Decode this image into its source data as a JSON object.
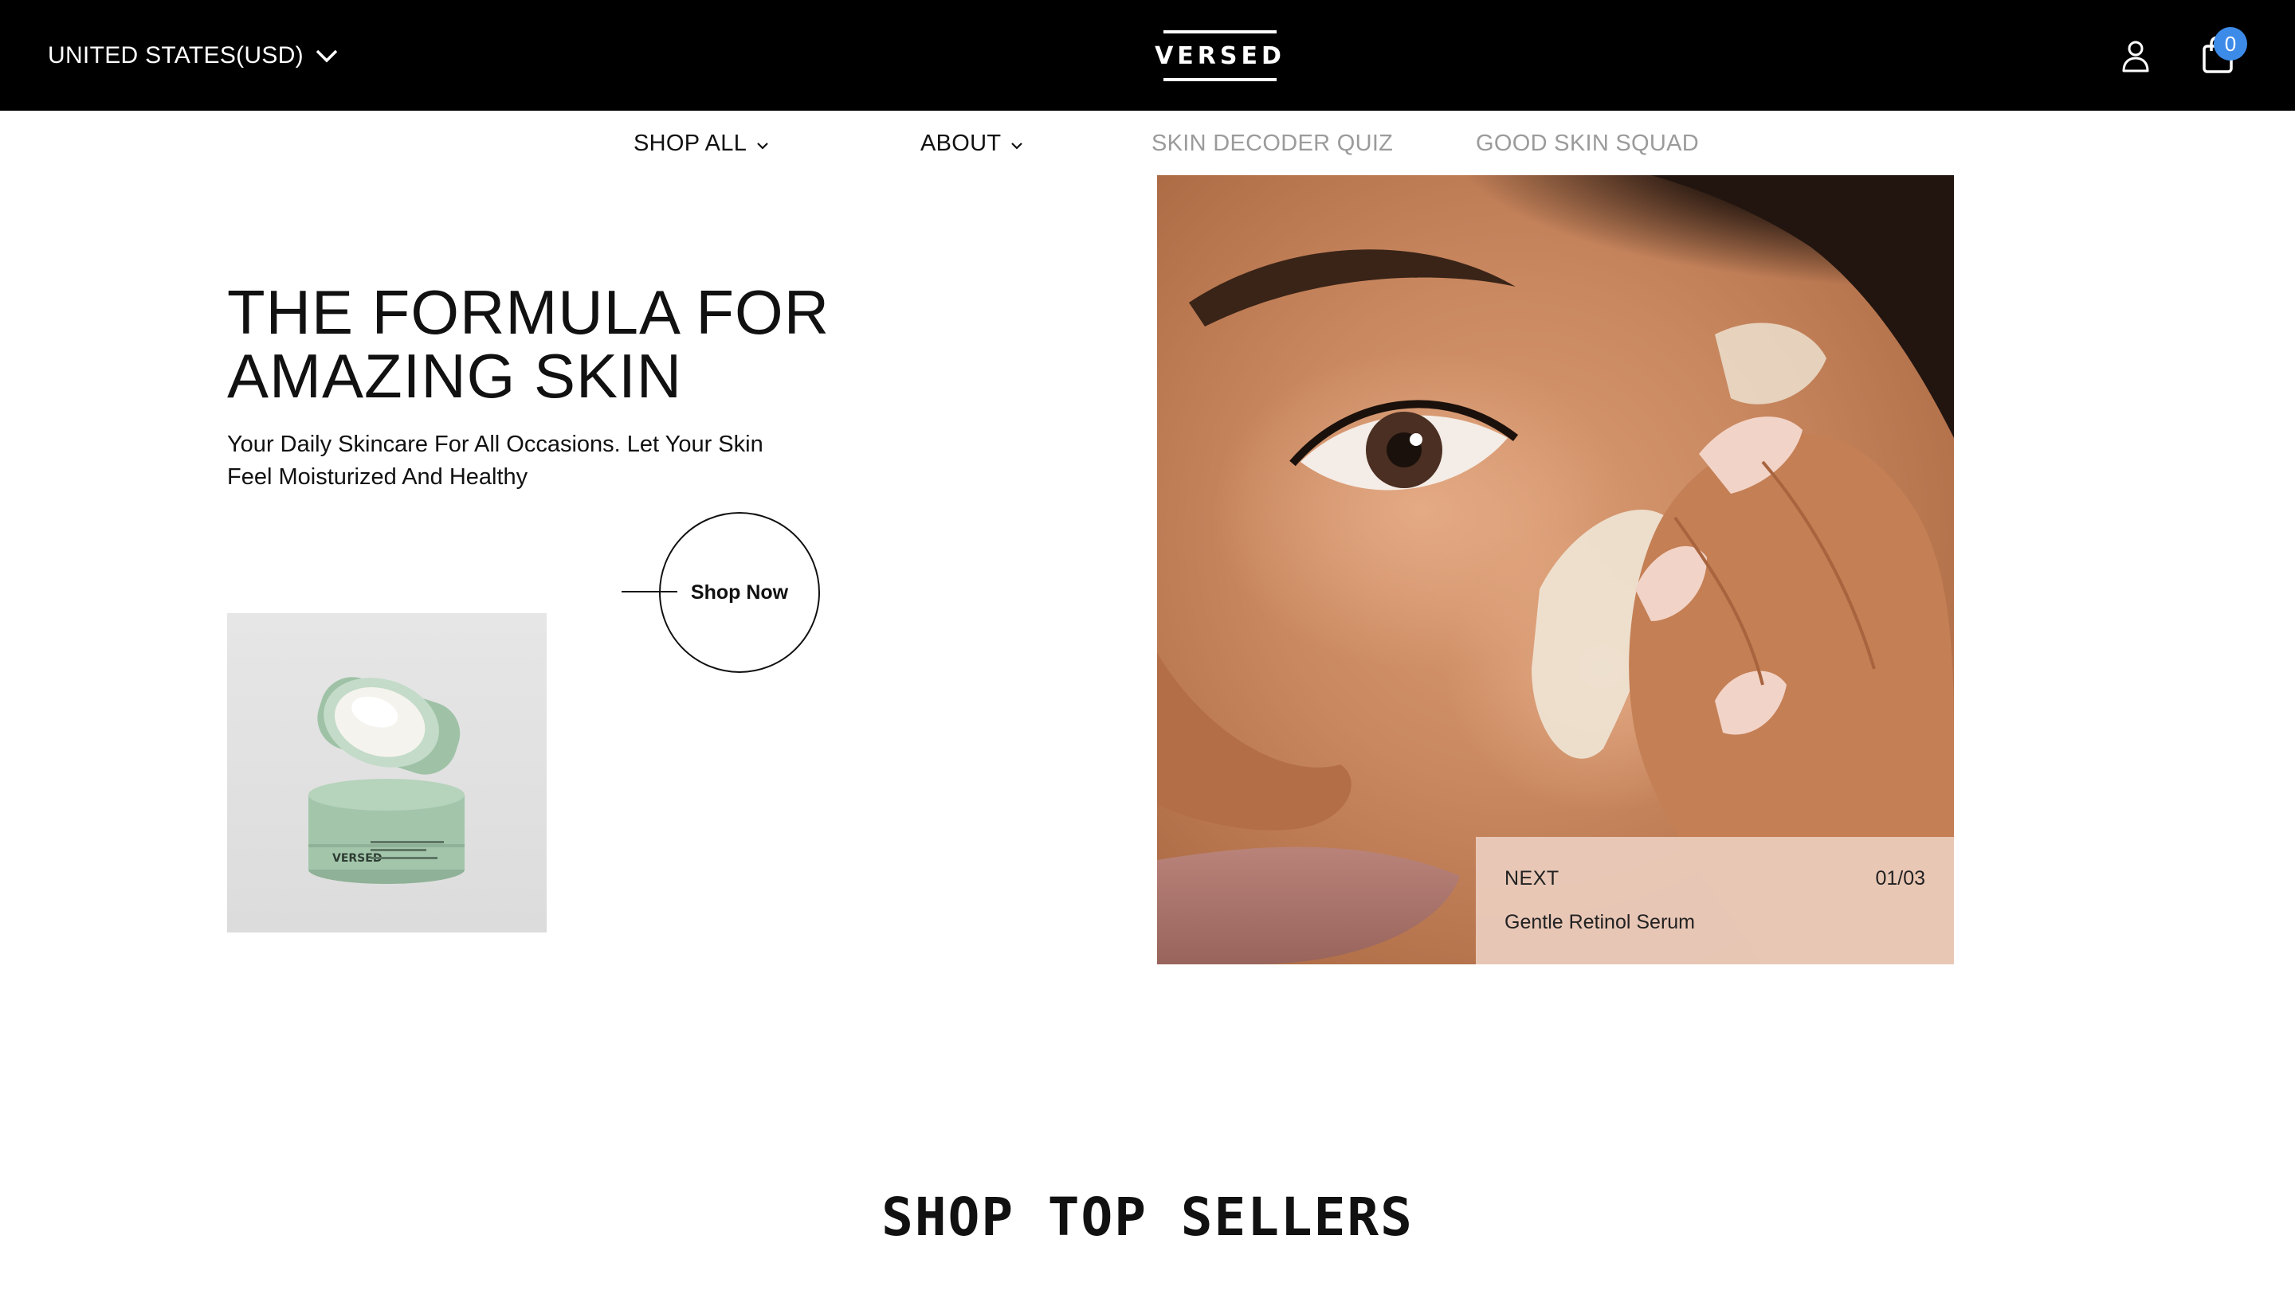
{
  "header": {
    "region_label": "UNITED STATES(USD)",
    "logo_text": "VERSED",
    "cart_count": "0",
    "icons": {
      "region": "chevron-down-icon",
      "account": "user-icon",
      "cart": "shopping-bag-icon"
    }
  },
  "nav": {
    "items": [
      {
        "label": "SHOP ALL",
        "has_dropdown": true
      },
      {
        "label": "ABOUT",
        "has_dropdown": true
      },
      {
        "label": "SKIN DECODER QUIZ",
        "has_dropdown": false
      },
      {
        "label": "GOOD SKIN SQUAD",
        "has_dropdown": false
      }
    ]
  },
  "hero": {
    "title_line1": "THE FORMULA FOR",
    "title_line2": "AMAZING SKIN",
    "subtitle_line1": "Your Daily Skincare For All Occasions. Let Your Skin",
    "subtitle_line2": "Feel Moisturized And Healthy",
    "cta_label": "Shop Now",
    "product_jar_brand": "VERSED",
    "slider": {
      "next_label": "NEXT",
      "counter": "01/03",
      "next_product": "Gentle Retinol Serum"
    }
  },
  "sections": {
    "top_sellers_title": "SHOP TOP SELLERS"
  },
  "colors": {
    "topbar": "#000000",
    "badge": "#3d8be8",
    "nav_muted": "#9b9b9b",
    "jar_green": "#9fc2a7",
    "next_panel": "#ecccbe"
  }
}
